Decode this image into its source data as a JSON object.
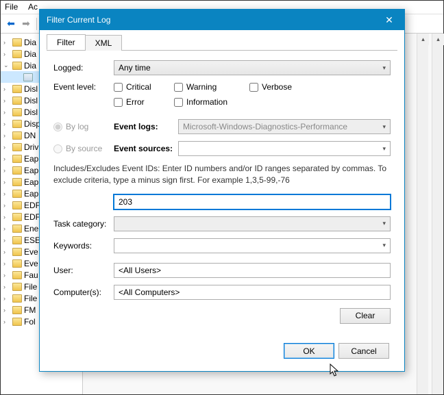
{
  "menu": {
    "file": "File",
    "ac": "Ac"
  },
  "tree": {
    "items": [
      {
        "icon": "folder",
        "label": "Dia",
        "exp": ""
      },
      {
        "icon": "folder",
        "label": "Dia",
        "exp": ""
      },
      {
        "icon": "folder",
        "label": "Dia",
        "exp": "v"
      },
      {
        "icon": "log",
        "label": "",
        "exp": "",
        "selected": true,
        "indent": true
      },
      {
        "icon": "folder",
        "label": "Disl",
        "exp": ""
      },
      {
        "icon": "folder",
        "label": "Disl",
        "exp": ""
      },
      {
        "icon": "folder",
        "label": "Disl",
        "exp": ""
      },
      {
        "icon": "folder",
        "label": "Disp",
        "exp": ""
      },
      {
        "icon": "folder",
        "label": "DN",
        "exp": ""
      },
      {
        "icon": "folder",
        "label": "Driv",
        "exp": ""
      },
      {
        "icon": "folder",
        "label": "Eap",
        "exp": ""
      },
      {
        "icon": "folder",
        "label": "Eap",
        "exp": ""
      },
      {
        "icon": "folder",
        "label": "Eap",
        "exp": ""
      },
      {
        "icon": "folder",
        "label": "Eap",
        "exp": ""
      },
      {
        "icon": "folder",
        "label": "EDF",
        "exp": ""
      },
      {
        "icon": "folder",
        "label": "EDF",
        "exp": ""
      },
      {
        "icon": "folder",
        "label": "Ene",
        "exp": ""
      },
      {
        "icon": "folder",
        "label": "ESE",
        "exp": ""
      },
      {
        "icon": "folder",
        "label": "Eve",
        "exp": ""
      },
      {
        "icon": "folder",
        "label": "Eve",
        "exp": ""
      },
      {
        "icon": "folder",
        "label": "Fau",
        "exp": ""
      },
      {
        "icon": "folder",
        "label": "File",
        "exp": ""
      },
      {
        "icon": "folder",
        "label": "File",
        "exp": ""
      },
      {
        "icon": "folder",
        "label": "FM",
        "exp": ""
      },
      {
        "icon": "folder",
        "label": "Fol",
        "exp": ""
      }
    ]
  },
  "dialog": {
    "title": "Filter Current Log",
    "tabs": {
      "filter": "Filter",
      "xml": "XML"
    },
    "labels": {
      "logged": "Logged:",
      "event_level": "Event level:",
      "by_log": "By log",
      "by_source": "By source",
      "event_logs": "Event logs:",
      "event_sources": "Event sources:",
      "task_category": "Task category:",
      "keywords": "Keywords:",
      "user": "User:",
      "computers": "Computer(s):"
    },
    "logged_value": "Any time",
    "checks": {
      "critical": "Critical",
      "warning": "Warning",
      "verbose": "Verbose",
      "error": "Error",
      "information": "Information"
    },
    "event_logs_value": "Microsoft-Windows-Diagnostics-Performance",
    "event_sources_value": "",
    "help_text": "Includes/Excludes Event IDs: Enter ID numbers and/or ID ranges separated by commas. To exclude criteria, type a minus sign first. For example 1,3,5-99,-76",
    "event_id_value": "203",
    "task_category_value": "",
    "keywords_value": "",
    "user_value": "<All Users>",
    "computers_value": "<All Computers>",
    "buttons": {
      "clear": "Clear",
      "ok": "OK",
      "cancel": "Cancel"
    }
  }
}
